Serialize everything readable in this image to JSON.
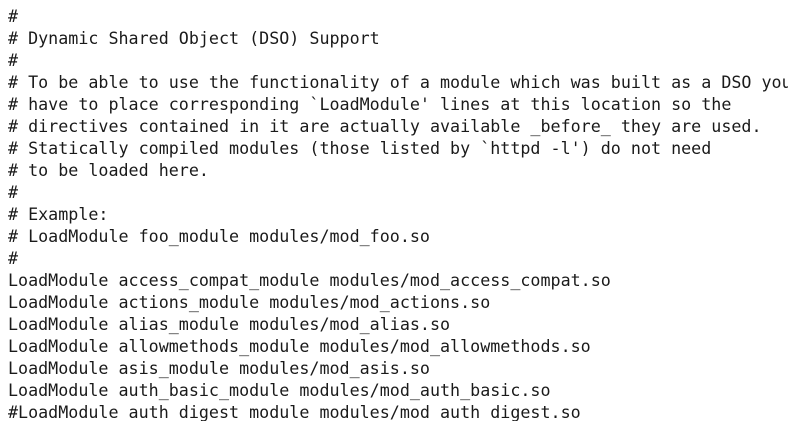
{
  "editor": {
    "lines": [
      "#",
      "# Dynamic Shared Object (DSO) Support",
      "#",
      "# To be able to use the functionality of a module which was built as a DSO you",
      "# have to place corresponding `LoadModule' lines at this location so the",
      "# directives contained in it are actually available _before_ they are used.",
      "# Statically compiled modules (those listed by `httpd -l') do not need",
      "# to be loaded here.",
      "#",
      "# Example:",
      "# LoadModule foo_module modules/mod_foo.so",
      "#",
      "LoadModule access_compat_module modules/mod_access_compat.so",
      "LoadModule actions_module modules/mod_actions.so",
      "LoadModule alias_module modules/mod_alias.so",
      "LoadModule allowmethods_module modules/mod_allowmethods.so",
      "LoadModule asis_module modules/mod_asis.so",
      "LoadModule auth_basic_module modules/mod_auth_basic.so",
      "#LoadModule auth_digest_module modules/mod_auth_digest.so"
    ]
  }
}
